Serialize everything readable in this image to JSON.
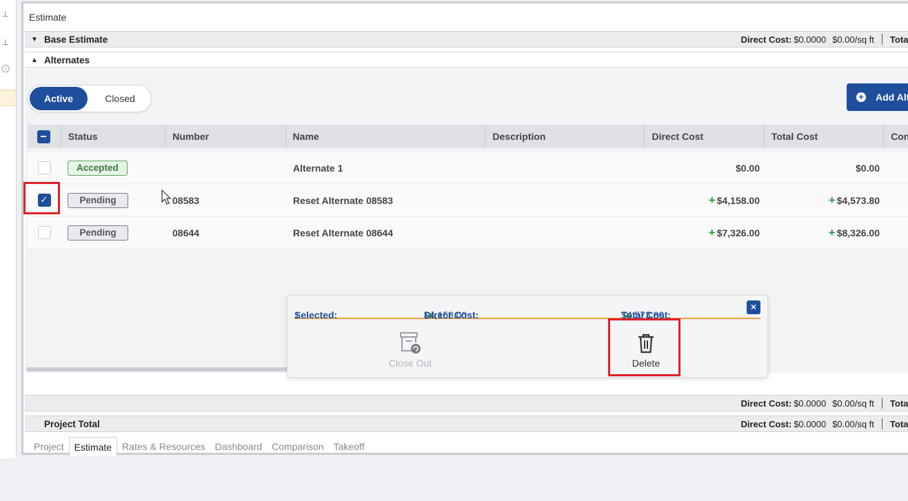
{
  "window": {
    "title": "Estimate"
  },
  "base_bar": {
    "title": "Base Estimate",
    "direct_cost_label": "Direct Cost:",
    "direct_cost_value": "$0.0000",
    "per_sqft": "$0.00/sq ft",
    "total_label": "Total"
  },
  "alternates_bar": {
    "title": "Alternates"
  },
  "toggle": {
    "active": "Active",
    "closed": "Closed"
  },
  "add_button": {
    "label": "Add Alt"
  },
  "table": {
    "columns": [
      "Status",
      "Number",
      "Name",
      "Description",
      "Direct Cost",
      "Total Cost",
      "Con"
    ],
    "rows": [
      {
        "checked": false,
        "status": "Accepted",
        "number": "",
        "name": "Alternate 1",
        "description": "",
        "direct_cost": "$0.00",
        "total_cost": "$0.00"
      },
      {
        "checked": true,
        "status": "Pending",
        "number": "08583",
        "name": "Reset Alternate 08583",
        "description": "",
        "direct_cost": "$4,158.00",
        "total_cost": "$4,573.80"
      },
      {
        "checked": false,
        "status": "Pending",
        "number": "08644",
        "name": "Reset Alternate 08644",
        "description": "",
        "direct_cost": "$7,326.00",
        "total_cost": "$8,326.00"
      }
    ]
  },
  "selection": {
    "selected_label": "Selected:",
    "selected_count": "1",
    "direct_cost_label": "Direct Cost:",
    "direct_cost_value": "$4,158.00",
    "total_cost_label": "Total Cost:",
    "total_cost_value": "$4,573.80",
    "close_out_label": "Close Out",
    "delete_label": "Delete"
  },
  "summary_bar": {
    "direct_cost_label": "Direct Cost:",
    "direct_cost_value": "$0.0000",
    "per_sqft": "$0.00/sq ft",
    "total_label": "Total"
  },
  "project_total_bar": {
    "title": "Project Total",
    "direct_cost_label": "Direct Cost:",
    "direct_cost_value": "$0.0000",
    "per_sqft": "$0.00/sq ft",
    "total_label": "Total"
  },
  "tabs": [
    "Project",
    "Estimate",
    "Rates & Resources",
    "Dashboard",
    "Comparison",
    "Takeoff"
  ],
  "colors": {
    "primary": "#1f4e9c",
    "positive": "#2b9a3a",
    "highlight": "#e0202a",
    "accent": "#f0a040"
  }
}
